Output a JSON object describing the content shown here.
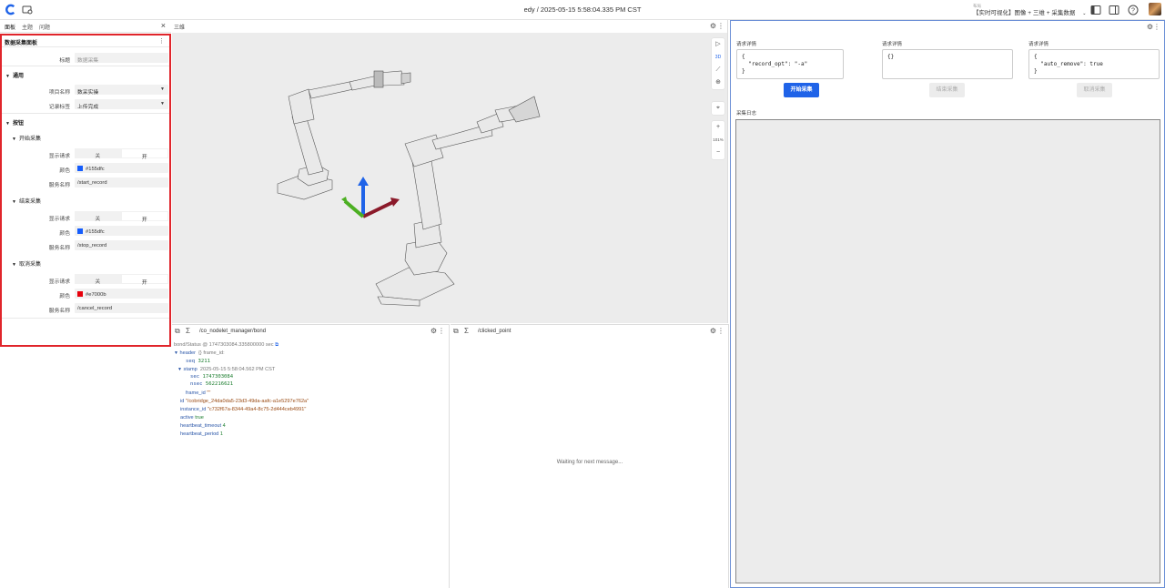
{
  "topbar": {
    "title": "edy / 2025-05-15 5:58:04.335 PM CST",
    "layout_small": "布局",
    "layout_name": "【实时可视化】图像 + 三维 + 采集数据"
  },
  "left": {
    "tabs": [
      "面板",
      "主题",
      "问题"
    ],
    "panel_title": "数据采集面板",
    "title_label": "标题",
    "title_value": "数据采集",
    "general": {
      "label": "通用",
      "project_label": "项目名称",
      "project_value": "数采实操",
      "record_label": "记录标签",
      "record_value": "上传完成"
    },
    "buttons": {
      "label": "按钮",
      "groups": [
        {
          "name": "开始采集",
          "show_label": "显示请求",
          "off": "关",
          "on": "开",
          "color_label": "颜色",
          "color": "#155dfc",
          "service_label": "服务名称",
          "service": "/start_record"
        },
        {
          "name": "结束采集",
          "show_label": "显示请求",
          "off": "关",
          "on": "开",
          "color_label": "颜色",
          "color": "#155dfc",
          "service_label": "服务名称",
          "service": "/stop_record"
        },
        {
          "name": "取消采集",
          "show_label": "显示请求",
          "off": "关",
          "on": "开",
          "color_label": "颜色",
          "color": "#e7000b",
          "service_label": "服务名称",
          "service": "/cancel_record"
        }
      ]
    }
  },
  "view3d": {
    "title": "三维",
    "tools": [
      "▷",
      "3D",
      "⟋",
      "⊕",
      "⌖",
      "+",
      "101%",
      "−"
    ]
  },
  "raw": {
    "title": "/co_nodelet_manager/bond",
    "meta": "bond/Status @ 1747303084.335800000 sec",
    "header": "header",
    "header_hint": "{} frame_id:",
    "seq_k": "seq",
    "seq_v": "3211",
    "stamp_k": "stamp",
    "stamp_v": "2025-05-15 5:58:04.562 PM CST",
    "sec_k": "sec",
    "sec_v": "1747303084",
    "nsec_k": "nsec",
    "nsec_v": "562216621",
    "frame_k": "frame_id",
    "frame_v": "\"\"",
    "id_k": "id",
    "id_v": "\"/cobridge_24da0da5-23d3-49da-aafc-a1e5297e762a\"",
    "inst_k": "instance_id",
    "inst_v": "\"c732f67a-8344-49a4-8c75-2d444ceb4991\"",
    "active_k": "active",
    "active_v": "true",
    "hbt_k": "heartbeat_timeout",
    "hbt_v": "4",
    "hbp_k": "heartbeat_period",
    "hbp_v": "1"
  },
  "clicked": {
    "title": "/clicked_point",
    "waiting": "Waiting for next message..."
  },
  "collect": {
    "req_label": "请求详情",
    "req1": "{\n  \"record_opt\": \"-a\"\n}",
    "req2": "{}",
    "req3": "{\n  \"auto_remove\": true\n}",
    "btn_start": "开始采集",
    "btn_stop": "结束采集",
    "btn_cancel": "取消采集",
    "log_label": "采集日志"
  },
  "colors": {
    "accent": "#1f63e8",
    "highlight_border": "#e0252b"
  }
}
